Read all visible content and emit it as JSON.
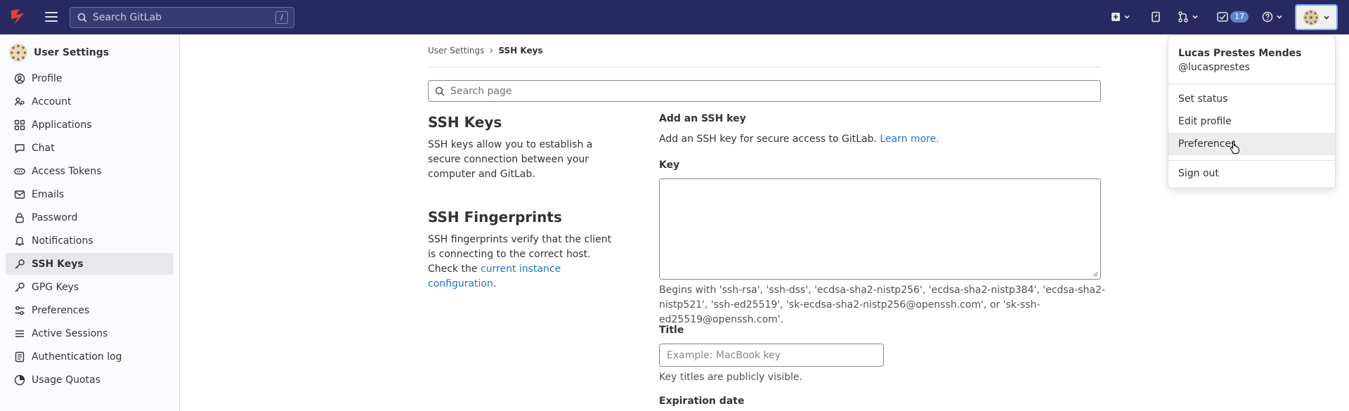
{
  "topbar": {
    "search_placeholder": "Search GitLab",
    "search_shortcut": "/",
    "todos_count": "17",
    "icons": [
      "gitlab-logo",
      "hamburger-icon",
      "search-icon",
      "plus-square-icon",
      "issues-icon",
      "merge-request-icon",
      "todo-icon",
      "help-icon",
      "avatar"
    ]
  },
  "sidebar": {
    "title": "User Settings",
    "items": [
      {
        "label": "Profile",
        "icon": "profile-icon"
      },
      {
        "label": "Account",
        "icon": "account-icon"
      },
      {
        "label": "Applications",
        "icon": "applications-icon"
      },
      {
        "label": "Chat",
        "icon": "chat-icon"
      },
      {
        "label": "Access Tokens",
        "icon": "token-icon"
      },
      {
        "label": "Emails",
        "icon": "mail-icon"
      },
      {
        "label": "Password",
        "icon": "lock-icon"
      },
      {
        "label": "Notifications",
        "icon": "bell-icon"
      },
      {
        "label": "SSH Keys",
        "icon": "key-icon",
        "active": true
      },
      {
        "label": "GPG Keys",
        "icon": "key-icon"
      },
      {
        "label": "Preferences",
        "icon": "preferences-icon"
      },
      {
        "label": "Active Sessions",
        "icon": "sessions-icon"
      },
      {
        "label": "Authentication log",
        "icon": "log-icon"
      },
      {
        "label": "Usage Quotas",
        "icon": "quota-icon"
      }
    ]
  },
  "breadcrumb": {
    "parent": "User Settings",
    "current": "SSH Keys"
  },
  "page_search": {
    "placeholder": "Search page"
  },
  "ssh_keys": {
    "heading": "SSH Keys",
    "description": "SSH keys allow you to establish a secure connection between your computer and GitLab."
  },
  "ssh_fingerprints": {
    "heading": "SSH Fingerprints",
    "description": "SSH fingerprints verify that the client is connecting to the correct host. Check the",
    "link": "current instance configuration",
    "after_link": "."
  },
  "add_key": {
    "heading": "Add an SSH key",
    "intro": "Add an SSH key for secure access to GitLab.",
    "intro_link": "Learn more.",
    "key_label": "Key",
    "key_help": "Begins with 'ssh-rsa', 'ssh-dss', 'ecdsa-sha2-nistp256', 'ecdsa-sha2-nistp384', 'ecdsa-sha2-nistp521', 'ssh-ed25519', 'sk-ecdsa-sha2-nistp256@openssh.com', or 'sk-ssh-ed25519@openssh.com'.",
    "title_label": "Title",
    "title_placeholder": "Example: MacBook key",
    "title_help": "Key titles are publicly visible.",
    "expiration_label": "Expiration date"
  },
  "user_menu": {
    "name": "Lucas Prestes Mendes",
    "username": "@lucasprestes",
    "items": [
      "Set status",
      "Edit profile",
      "Preferences",
      "Sign out"
    ],
    "hovered": "Preferences"
  },
  "colors": {
    "topbar": "#292961",
    "link": "#1f75cb",
    "avatar_focus": "#6faaff"
  }
}
